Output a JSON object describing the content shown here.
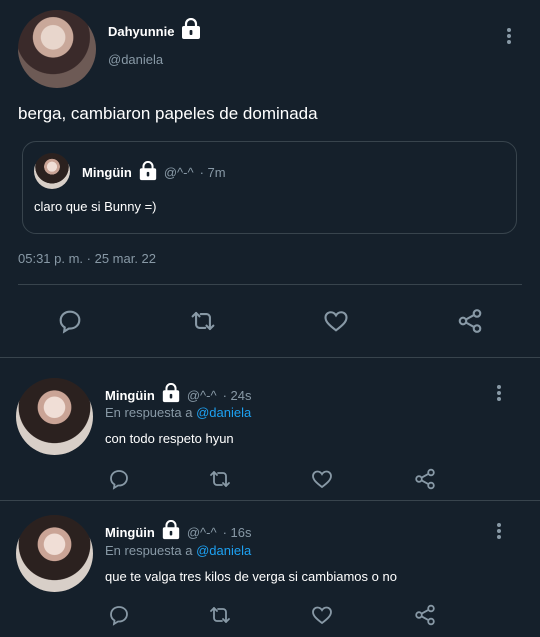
{
  "main_tweet": {
    "author_name": "Dahyunnie",
    "author_handle": "@daniela",
    "text": "berga, cambiaron papeles de dominada",
    "timestamp": "05:31 p. m. · 25 mar. 22",
    "quote": {
      "author_name": "Mingüin",
      "author_handle": "@^-^",
      "time": "· 7m",
      "text": "claro que si Bunny =)"
    }
  },
  "replies": [
    {
      "author_name": "Mingüin",
      "author_handle": "@^-^",
      "time": "· 24s",
      "reply_prefix": "En respuesta a",
      "reply_to": "@daniela",
      "text": "con todo respeto hyun"
    },
    {
      "author_name": "Mingüin",
      "author_handle": "@^-^",
      "time": "· 16s",
      "reply_prefix": "En respuesta a",
      "reply_to": "@daniela",
      "text": "que te valga tres kilos de verga si cambiamos o no"
    }
  ],
  "colors": {
    "background": "#15202b",
    "muted": "#8899a6",
    "link": "#1da1f2",
    "divider": "#38444d"
  },
  "icons": [
    "lock-icon",
    "more-icon",
    "reply-icon",
    "retweet-icon",
    "like-icon",
    "share-icon"
  ]
}
